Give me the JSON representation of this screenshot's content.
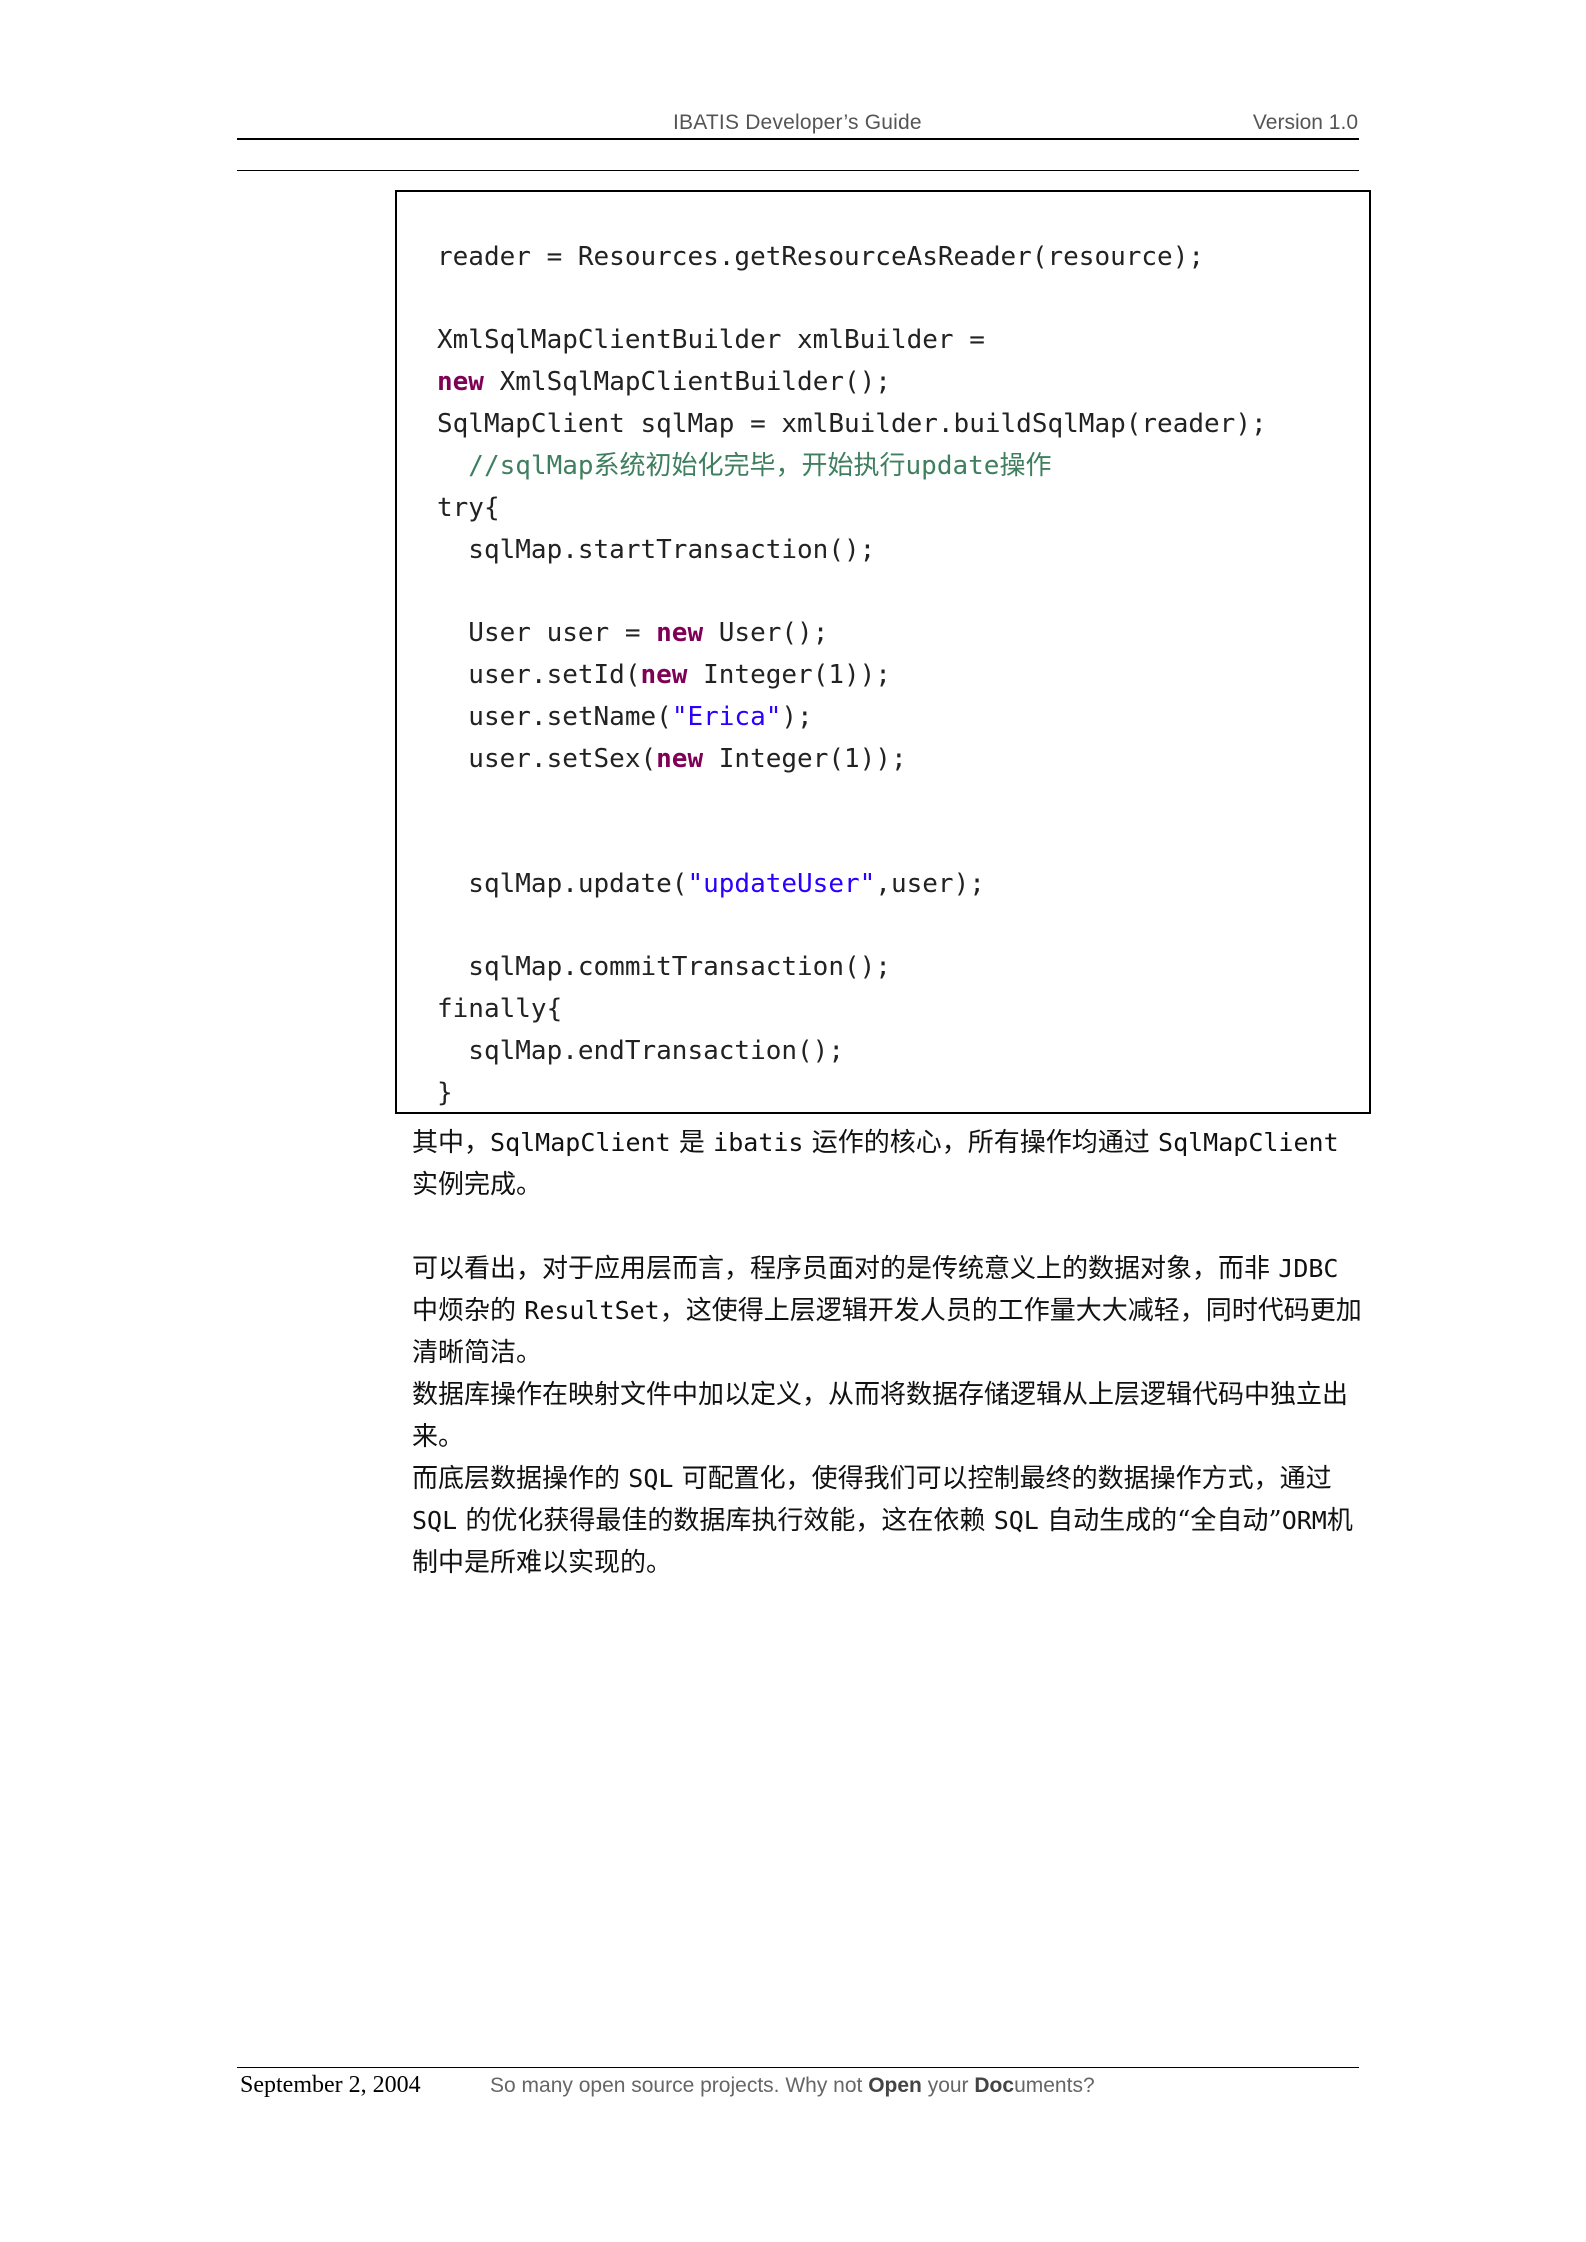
{
  "header": {
    "title": "IBATIS Developer’s Guide",
    "version": "Version 1.0"
  },
  "code": {
    "l1": "reader = Resources.getResourceAsReader(resource);",
    "l2": "XmlSqlMapClientBuilder xmlBuilder =",
    "l3_kw": "new",
    "l3_rest": " XmlSqlMapClientBuilder();",
    "l4": "SqlMapClient sqlMap = xmlBuilder.buildSqlMap(reader);",
    "l5_comment": "  //sqlMap系统初始化完毕，开始执行update操作",
    "l6": "try{",
    "l7": "  sqlMap.startTransaction();",
    "l8_a": "  User user = ",
    "l8_kw": "new",
    "l8_b": " User();",
    "l9_a": "  user.setId(",
    "l9_kw": "new",
    "l9_b": " Integer(1));",
    "l10_a": "  user.setName(",
    "l10_str": "\"Erica\"",
    "l10_b": ");",
    "l11_a": "  user.setSex(",
    "l11_kw": "new",
    "l11_b": " Integer(1));",
    "l12_a": "  sqlMap.update(",
    "l12_str": "\"updateUser\"",
    "l12_b": ",user);",
    "l13": "  sqlMap.commitTransaction();",
    "l14": "finally{",
    "l15": "  sqlMap.endTransaction();",
    "l16": "}"
  },
  "paragraphs": {
    "p1_a": "其中，",
    "p1_m1": "SqlMapClient",
    "p1_b": " 是 ",
    "p1_m2": "ibatis",
    "p1_c": " 运作的核心，所有操作均通过 ",
    "p1_m3": "SqlMapClient",
    "p1_d": "实例完成。",
    "p2_a": "可以看出，对于应用层而言，程序员面对的是传统意义上的数据对象，而非 ",
    "p2_m1": "JDBC",
    "p2_b": "中烦杂的 ",
    "p2_m2": "ResultSet",
    "p2_c": "，这使得上层逻辑开发人员的工作量大大减轻，同时代码更加清晰简洁。",
    "p3": "数据库操作在映射文件中加以定义，从而将数据存储逻辑从上层逻辑代码中独立出来。",
    "p4_a": "而底层数据操作的 ",
    "p4_m1": "SQL",
    "p4_b": " 可配置化，使得我们可以控制最终的数据操作方式，通过",
    "p4_m2": "SQL",
    "p4_c": " 的优化获得最佳的数据库执行效能，这在依赖 ",
    "p4_m3": "SQL",
    "p4_d": " 自动生成的“全自动”",
    "p4_m4": "ORM",
    "p4_e": "机制中是所难以实现的。"
  },
  "footer": {
    "date": "September 2, 2004",
    "slogan_a": "So many open source projects. Why not ",
    "slogan_b1": "Open",
    "slogan_c": " your ",
    "slogan_b2": "Doc",
    "slogan_d": "uments?"
  }
}
